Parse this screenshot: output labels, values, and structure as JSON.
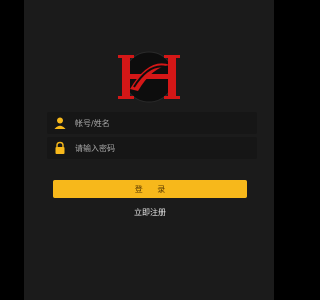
{
  "logo": {
    "letter": "H",
    "icon": "brand-h-logo",
    "colors": {
      "letter": "#d41717",
      "ring": "#111111"
    }
  },
  "login_form": {
    "username": {
      "placeholder": "帐号/姓名",
      "value": "",
      "icon": "user-icon"
    },
    "password": {
      "placeholder": "请输入密码",
      "value": "",
      "icon": "lock-icon"
    },
    "login_button_label": "登 录",
    "register_link_label": "立即注册"
  },
  "colors": {
    "accent": "#f7b81b",
    "panel": "#1b1b1b",
    "background": "#000000"
  }
}
